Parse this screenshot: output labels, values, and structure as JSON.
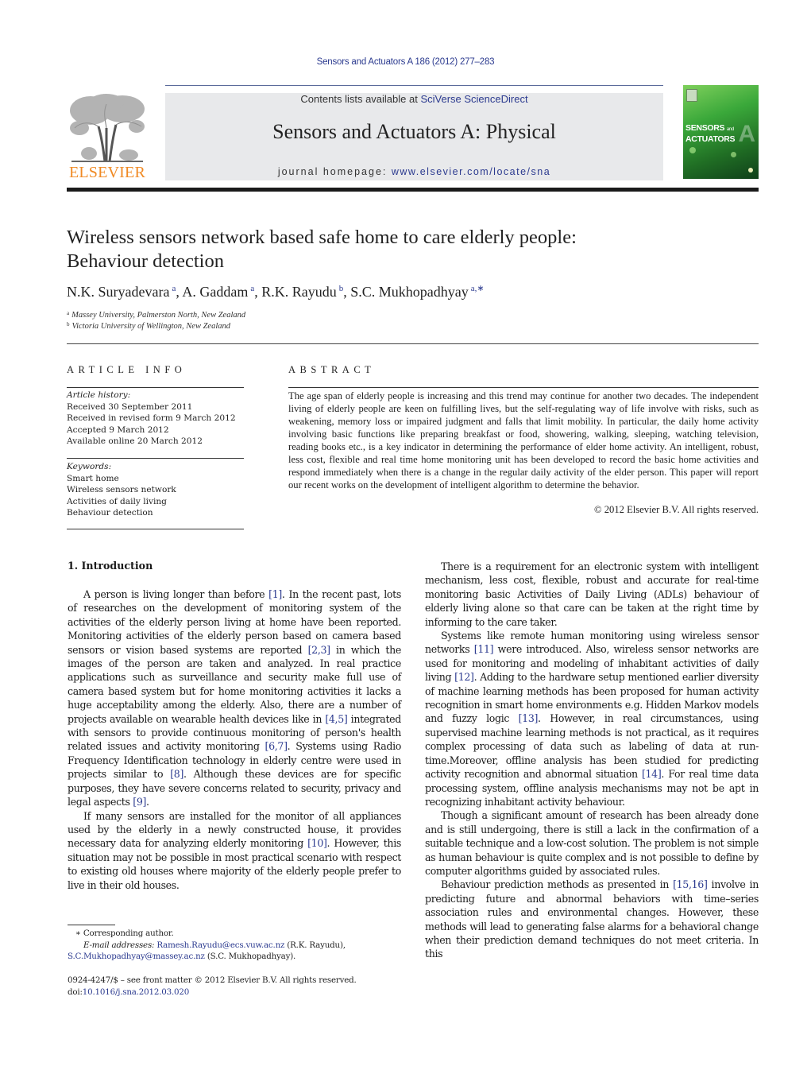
{
  "header": {
    "citation": "Sensors and Actuators A 186 (2012) 277–283",
    "publisher_logo_text": "ELSEVIER",
    "contents_prefix": "Contents lists available at ",
    "contents_link": "SciVerse ScienceDirect",
    "journal_title": "Sensors and Actuators A: Physical",
    "homepage_prefix": "journal homepage: ",
    "homepage_url": "www.elsevier.com/locate/sna",
    "cover_line1": "SENSORS",
    "cover_and": "and",
    "cover_line2": "ACTUATORS",
    "cover_letter": "A",
    "colors": {
      "link": "#2b3a8f",
      "elsevier_orange": "#f08a24",
      "band_grey": "#e8e9eb",
      "cover_green": "#3aa83a"
    }
  },
  "article": {
    "title_line1": "Wireless sensors network based safe home to care elderly people:",
    "title_line2": "Behaviour detection",
    "authors": [
      {
        "name": "N.K. Suryadevara",
        "sup": "a"
      },
      {
        "name": "A. Gaddam",
        "sup": "a"
      },
      {
        "name": "R.K. Rayudu",
        "sup": "b"
      },
      {
        "name": "S.C. Mukhopadhyay",
        "sup": "a,∗"
      }
    ],
    "affiliations": [
      {
        "sup": "a",
        "text": "Massey University, Palmerston North, New Zealand"
      },
      {
        "sup": "b",
        "text": "Victoria University of Wellington, New Zealand"
      }
    ]
  },
  "article_info": {
    "heading": "ARTICLE INFO",
    "history_label": "Article history:",
    "history": [
      "Received 30 September 2011",
      "Received in revised form 9 March 2012",
      "Accepted 9 March 2012",
      "Available online 20 March 2012"
    ],
    "keywords_label": "Keywords:",
    "keywords": [
      "Smart home",
      "Wireless sensors network",
      "Activities of daily living",
      "Behaviour detection"
    ]
  },
  "abstract": {
    "heading": "ABSTRACT",
    "text": "The age span of elderly people is increasing and this trend may continue for another two decades. The independent living of elderly people are keen on fulfilling lives, but the self-regulating way of life involve with risks, such as weakening, memory loss or impaired judgment and falls that limit mobility. In particular, the daily home activity involving basic functions like preparing breakfast or food, showering, walking, sleeping, watching television, reading books etc., is a key indicator in determining the performance of elder home activity. An intelligent, robust, less cost, flexible and real time home monitoring unit has been developed to record the basic home activities and respond immediately when there is a change in the regular daily activity of the elder person. This paper will report our recent works on the development of intelligent algorithm to determine the behavior.",
    "copyright": "© 2012 Elsevier B.V. All rights reserved."
  },
  "body": {
    "section_heading": "1.  Introduction",
    "left_paragraphs": [
      [
        {
          "t": "A person is living longer than before "
        },
        {
          "r": "[1]"
        },
        {
          "t": ". In the recent past, lots of researches on the development of monitoring system of the activities of the elderly person living at home have been reported. Monitoring activities of the elderly person based on camera based sensors or vision based systems are reported "
        },
        {
          "r": "[2,3]"
        },
        {
          "t": " in which the images of the person are taken and analyzed. In real practice applications such as surveillance and security make full use of camera based system but for home monitoring activities it lacks a huge acceptability among the elderly. Also, there are a number of projects available on wearable health devices like in "
        },
        {
          "r": "[4,5]"
        },
        {
          "t": " integrated with sensors to provide continuous monitoring of person's health related issues and activity monitoring "
        },
        {
          "r": "[6,7]"
        },
        {
          "t": ". Systems using Radio Frequency Identification technology in elderly centre were used in projects similar to "
        },
        {
          "r": "[8]"
        },
        {
          "t": ". Although these devices are for specific purposes, they have severe concerns related to security, privacy and legal aspects "
        },
        {
          "r": "[9]"
        },
        {
          "t": "."
        }
      ],
      [
        {
          "t": "If many sensors are installed for the monitor of all appliances used by the elderly in a newly constructed house, it provides necessary data for analyzing elderly monitoring "
        },
        {
          "r": "[10]"
        },
        {
          "t": ". However, this situation may not be possible in most practical scenario with respect to existing old houses where majority of the elderly people prefer to live in their old houses."
        }
      ]
    ],
    "right_paragraphs": [
      [
        {
          "t": "There is a requirement for an electronic system with intelligent mechanism, less cost, flexible, robust and accurate for real-time monitoring basic Activities of Daily Living (ADLs) behaviour of elderly living alone so that care can be taken at the right time by informing to the care taker."
        }
      ],
      [
        {
          "t": "Systems like remote human monitoring using wireless sensor networks "
        },
        {
          "r": "[11]"
        },
        {
          "t": " were introduced. Also, wireless sensor networks are used for monitoring and modeling of inhabitant activities of daily living "
        },
        {
          "r": "[12]"
        },
        {
          "t": ". Adding to the hardware setup mentioned earlier diversity of machine learning methods has been proposed for human activity recognition in smart home environments e.g. Hidden Markov models and fuzzy logic "
        },
        {
          "r": "[13]"
        },
        {
          "t": ". However, in real circumstances, using supervised machine learning methods is not practical, as it requires complex processing of data such as labeling of data at run-time.Moreover, offline analysis has been studied for predicting activity recognition and abnormal situation "
        },
        {
          "r": "[14]"
        },
        {
          "t": ". For real time data processing system, offline analysis mechanisms may not be apt in recognizing inhabitant activity behaviour."
        }
      ],
      [
        {
          "t": "Though a significant amount of research has been already done and is still undergoing, there is still a lack in the confirmation of a suitable technique and a low-cost solution. The problem is not simple as human behaviour is quite complex and is not possible to define by computer algorithms guided by associated rules."
        }
      ],
      [
        {
          "t": "Behaviour prediction methods as presented in "
        },
        {
          "r": "[15,16]"
        },
        {
          "t": " involve in predicting future and abnormal behaviors with time–series association rules and environmental changes. However, these methods will lead to generating false alarms for a behavioral change when their prediction demand techniques do not meet criteria. In this"
        }
      ]
    ]
  },
  "footnotes": {
    "corresponding": "∗ Corresponding author.",
    "email_label": "E-mail addresses: ",
    "email1": "Ramesh.Rayudu@ecs.vuw.ac.nz",
    "email1_owner": " (R.K. Rayudu),",
    "email2": "S.C.Mukhopadhyay@massey.ac.nz",
    "email2_owner": " (S.C. Mukhopadhyay).",
    "issn_line": "0924-4247/$ – see front matter © 2012 Elsevier B.V. All rights reserved.",
    "doi_prefix": "doi:",
    "doi": "10.1016/j.sna.2012.03.020"
  }
}
